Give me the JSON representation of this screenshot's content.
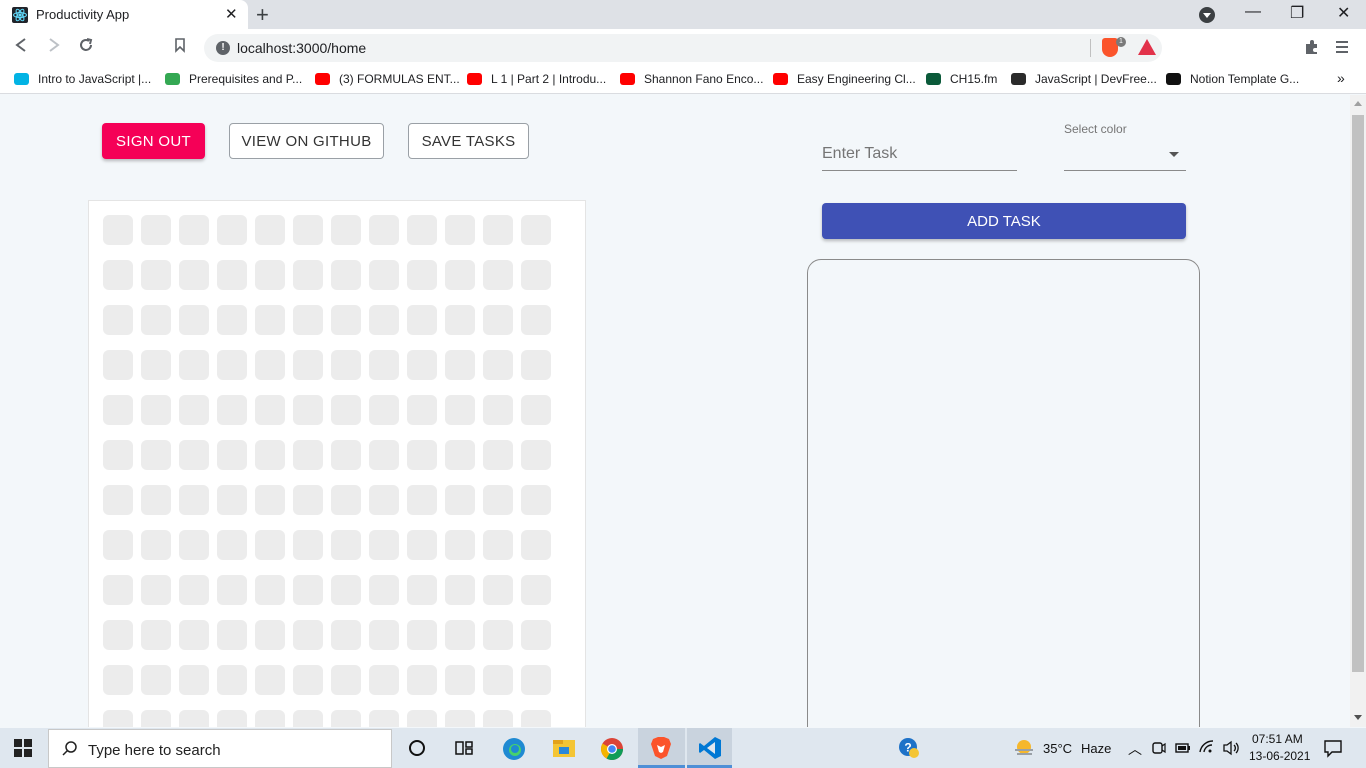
{
  "browser": {
    "tab_title": "Productivity App",
    "tab_close": "✕",
    "new_tab": "+",
    "url": "localhost:3000/home",
    "shield_count": "1",
    "window_controls": {
      "minimize": "—",
      "restore": "❐",
      "close": "✕"
    }
  },
  "bookmarks": [
    {
      "label": "Intro to JavaScript |...",
      "icon": "udacity-icon",
      "color": "#02b3e4"
    },
    {
      "label": "Prerequisites and P...",
      "icon": "code-icon",
      "color": "#34a853"
    },
    {
      "label": "(3) FORMULAS ENT...",
      "icon": "youtube-icon",
      "color": "#ff0000"
    },
    {
      "label": "L 1 | Part 2 | Introdu...",
      "icon": "youtube-icon",
      "color": "#ff0000"
    },
    {
      "label": "Shannon Fano Enco...",
      "icon": "youtube-icon",
      "color": "#ff0000"
    },
    {
      "label": "Easy Engineering Cl...",
      "icon": "youtube-icon",
      "color": "#ff0000"
    },
    {
      "label": "CH15.fm",
      "icon": "shield-crest-icon",
      "color": "#0b5a3a"
    },
    {
      "label": "JavaScript | DevFree...",
      "icon": "devfree-icon",
      "color": "#2b2b2b"
    },
    {
      "label": "Notion Template G...",
      "icon": "notion-icon",
      "color": "#111111"
    }
  ],
  "bookmarks_more": "»",
  "app": {
    "sign_out": "SIGN OUT",
    "view_github": "VIEW ON GITHUB",
    "save_tasks": "SAVE TASKS",
    "task_placeholder": "Enter Task",
    "color_label": "Select color",
    "add_task": "ADD TASK",
    "accent_color": "#f50057",
    "primary_color": "#3f51b5",
    "grid_rows": 12,
    "grid_cols": 12
  },
  "taskbar": {
    "search_placeholder": "Type here to search",
    "temperature": "35°C",
    "weather": "Haze",
    "time": "07:51 AM",
    "date": "13-06-2021"
  }
}
